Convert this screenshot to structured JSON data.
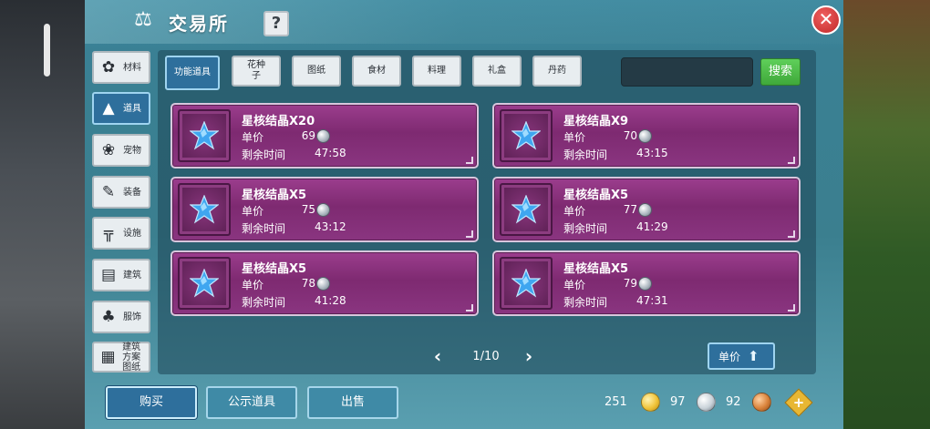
{
  "window": {
    "title": "交易所",
    "help_label": "?",
    "close_label": "✕"
  },
  "categories": [
    {
      "label": "材料",
      "icon": "ore-icon",
      "active": false
    },
    {
      "label": "道具",
      "icon": "potion-icon",
      "active": true
    },
    {
      "label": "宠物",
      "icon": "paw-icon",
      "active": false
    },
    {
      "label": "装备",
      "icon": "armor-icon",
      "active": false
    },
    {
      "label": "设施",
      "icon": "facility-icon",
      "active": false
    },
    {
      "label": "建筑",
      "icon": "brick-icon",
      "active": false
    },
    {
      "label": "服饰",
      "icon": "shirt-icon",
      "active": false
    },
    {
      "label": "建筑方案图纸",
      "icon": "blueprint-icon",
      "active": false
    }
  ],
  "tabs": [
    {
      "label": "功能道具",
      "active": true
    },
    {
      "label": "花种子",
      "active": false
    },
    {
      "label": "图纸",
      "active": false
    },
    {
      "label": "食材",
      "active": false
    },
    {
      "label": "料理",
      "active": false
    },
    {
      "label": "礼盒",
      "active": false
    },
    {
      "label": "丹药",
      "active": false
    }
  ],
  "search": {
    "value": "",
    "button_label": "搜索"
  },
  "item_labels": {
    "price": "单价",
    "time_left": "剩余时间"
  },
  "items": [
    {
      "name": "星核结晶X20",
      "price": "69",
      "time": "47:58"
    },
    {
      "name": "星核结晶X9",
      "price": "70",
      "time": "43:15"
    },
    {
      "name": "星核结晶X5",
      "price": "75",
      "time": "43:12"
    },
    {
      "name": "星核结晶X5",
      "price": "77",
      "time": "41:29"
    },
    {
      "name": "星核结晶X5",
      "price": "78",
      "time": "41:28"
    },
    {
      "name": "星核结晶X5",
      "price": "79",
      "time": "47:31"
    }
  ],
  "pagination": {
    "text": "1/10",
    "prev": "‹",
    "next": "›"
  },
  "sort": {
    "label": "单价"
  },
  "bottom_buttons": {
    "buy": "购买",
    "public": "公示道具",
    "sell": "出售"
  },
  "currency": {
    "gold": "251",
    "silver": "97",
    "copper": "92",
    "gold_color": "#f0c43a",
    "silver_color": "#c9d2d9",
    "copper_color": "#d9823a",
    "add": "+"
  },
  "colors": {
    "accent": "#2e6f9c",
    "card": "#8a3580",
    "search_green": "#4fbf4a"
  }
}
